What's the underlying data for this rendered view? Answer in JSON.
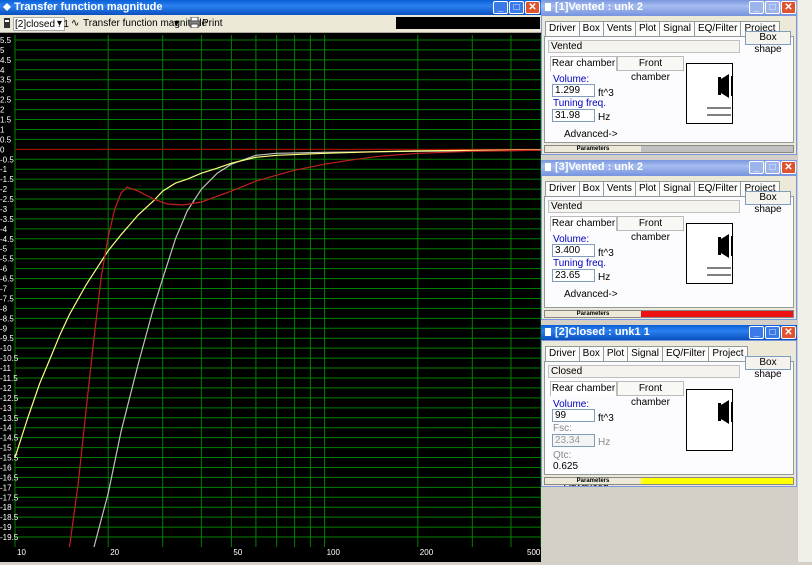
{
  "main_window": {
    "title": "Transfer function magnitude",
    "toolbar": {
      "selector": "[2]closed : 1",
      "view_button": "Transfer function magnitude",
      "print_button": "Print"
    }
  },
  "chart_data": {
    "type": "line",
    "xscale": "log",
    "xlim": [
      10,
      500
    ],
    "ylim": [
      -20,
      5.5
    ],
    "xtick_labels": [
      "10",
      "20",
      "50",
      "100",
      "200",
      "500"
    ],
    "ytick_labels": [
      "5.5",
      "5",
      "4.5",
      "4",
      "3.5",
      "3",
      "2.5",
      "2",
      "1.5",
      "1",
      "0.5",
      "0",
      "-0.5",
      "-1",
      "-1.5",
      "-2",
      "-2.5",
      "-3",
      "-3.5",
      "-4",
      "-4.5",
      "-5",
      "-5.5",
      "-6",
      "-6.5",
      "-7",
      "-7.5",
      "-8",
      "-8.5",
      "-9",
      "-9.5",
      "-10",
      "-10.5",
      "-11",
      "-11.5",
      "-12",
      "-12.5",
      "-13",
      "-13.5",
      "-14",
      "-14.5",
      "-15",
      "-15.5",
      "-16",
      "-16.5",
      "-17",
      "-17.5",
      "-18",
      "-18.5",
      "-19",
      "-19.5"
    ],
    "grid": true,
    "reference_line_y": 0,
    "colors": {
      "background": "#000000",
      "grid": "#008000",
      "reference": "#c00000"
    },
    "series": [
      {
        "color": "#c0c0c0",
        "points": [
          [
            18,
            -20
          ],
          [
            20,
            -17.3
          ],
          [
            22,
            -14.2
          ],
          [
            25,
            -10.8
          ],
          [
            28,
            -8
          ],
          [
            30,
            -6.5
          ],
          [
            33,
            -4.5
          ],
          [
            36,
            -3.1
          ],
          [
            40,
            -2
          ],
          [
            45,
            -1.2
          ],
          [
            50,
            -0.75
          ],
          [
            60,
            -0.3
          ],
          [
            70,
            -0.2
          ],
          [
            100,
            -0.15
          ],
          [
            200,
            -0.1
          ],
          [
            500,
            -0.05
          ]
        ]
      },
      {
        "color": "#ffff80",
        "points": [
          [
            10,
            -15.5
          ],
          [
            11,
            -13.5
          ],
          [
            12,
            -11.8
          ],
          [
            13,
            -10.5
          ],
          [
            14,
            -9.3
          ],
          [
            15,
            -8.3
          ],
          [
            17,
            -6.8
          ],
          [
            20,
            -5.1
          ],
          [
            22,
            -4.3
          ],
          [
            25,
            -3.3
          ],
          [
            28,
            -2.6
          ],
          [
            30,
            -2.1
          ],
          [
            33,
            -1.7
          ],
          [
            36,
            -1.5
          ],
          [
            40,
            -1.2
          ],
          [
            45,
            -0.95
          ],
          [
            50,
            -0.7
          ],
          [
            60,
            -0.4
          ],
          [
            70,
            -0.3
          ],
          [
            100,
            -0.2
          ],
          [
            150,
            -0.12
          ],
          [
            200,
            -0.08
          ],
          [
            300,
            -0.05
          ],
          [
            500,
            -0.03
          ]
        ]
      },
      {
        "color": "#c02020",
        "points": [
          [
            15,
            -20
          ],
          [
            16,
            -16.8
          ],
          [
            17,
            -13
          ],
          [
            18,
            -9.5
          ],
          [
            19,
            -6.4
          ],
          [
            20,
            -4.4
          ],
          [
            21,
            -3
          ],
          [
            22,
            -2.2
          ],
          [
            23,
            -1.9
          ],
          [
            25,
            -2.1
          ],
          [
            28,
            -2.5
          ],
          [
            31,
            -2.75
          ],
          [
            35,
            -2.8
          ],
          [
            40,
            -2.65
          ],
          [
            50,
            -2.1
          ],
          [
            60,
            -1.6
          ],
          [
            70,
            -1.3
          ],
          [
            80,
            -1.05
          ],
          [
            100,
            -0.75
          ],
          [
            120,
            -0.55
          ],
          [
            150,
            -0.35
          ],
          [
            200,
            -0.2
          ],
          [
            300,
            -0.1
          ],
          [
            500,
            -0.05
          ]
        ]
      }
    ]
  },
  "panels": [
    {
      "title": "[1]Vented : unk 2",
      "active": false,
      "tabs": [
        "Driver",
        "Box",
        "Vents",
        "Plot",
        "Signal",
        "EQ/Filter",
        "Project"
      ],
      "active_tab": "Box",
      "box_shape_button": "Box shape",
      "box_type": "Vented",
      "rear_chamber": "Rear chamber",
      "front_chamber": "Front chamber",
      "field1_label": "Volume:",
      "field1_value": "1.299",
      "field1_unit": "ft^3",
      "field2_label": "Tuning freq.",
      "field2_value": "31.98",
      "field2_unit": "Hz",
      "advanced": "Advanced->",
      "parameters": "Parameters",
      "param_color": "#c0c0c0"
    },
    {
      "title": "[3]Vented : unk 2",
      "active": false,
      "tabs": [
        "Driver",
        "Box",
        "Vents",
        "Plot",
        "Signal",
        "EQ/Filter",
        "Project"
      ],
      "active_tab": "Box",
      "box_shape_button": "Box shape",
      "box_type": "Vented",
      "rear_chamber": "Rear chamber",
      "front_chamber": "Front chamber",
      "field1_label": "Volume:",
      "field1_value": "3.400",
      "field1_unit": "ft^3",
      "field2_label": "Tuning freq.",
      "field2_value": "23.65",
      "field2_unit": "Hz",
      "advanced": "Advanced->",
      "parameters": "Parameters",
      "param_color": "#ee1111"
    },
    {
      "title": "[2]Closed : unk1 1",
      "active": true,
      "tabs": [
        "Driver",
        "Box",
        "Plot",
        "Signal",
        "EQ/Filter",
        "Project"
      ],
      "active_tab": "Box",
      "box_shape_button": "Box shape",
      "box_type": "Closed",
      "rear_chamber": "Rear chamber",
      "front_chamber": "Front chamber",
      "field1_label": "Volume:",
      "field1_value": "99",
      "field1_unit": "ft^3",
      "field2_label": "Fsc:",
      "field2_value": "23.34",
      "field2_unit": "Hz",
      "qtc_label": "Qtc:",
      "qtc_value": "0.625",
      "advanced": "Advanced->",
      "parameters": "Parameters",
      "param_color": "#ffff00"
    }
  ]
}
